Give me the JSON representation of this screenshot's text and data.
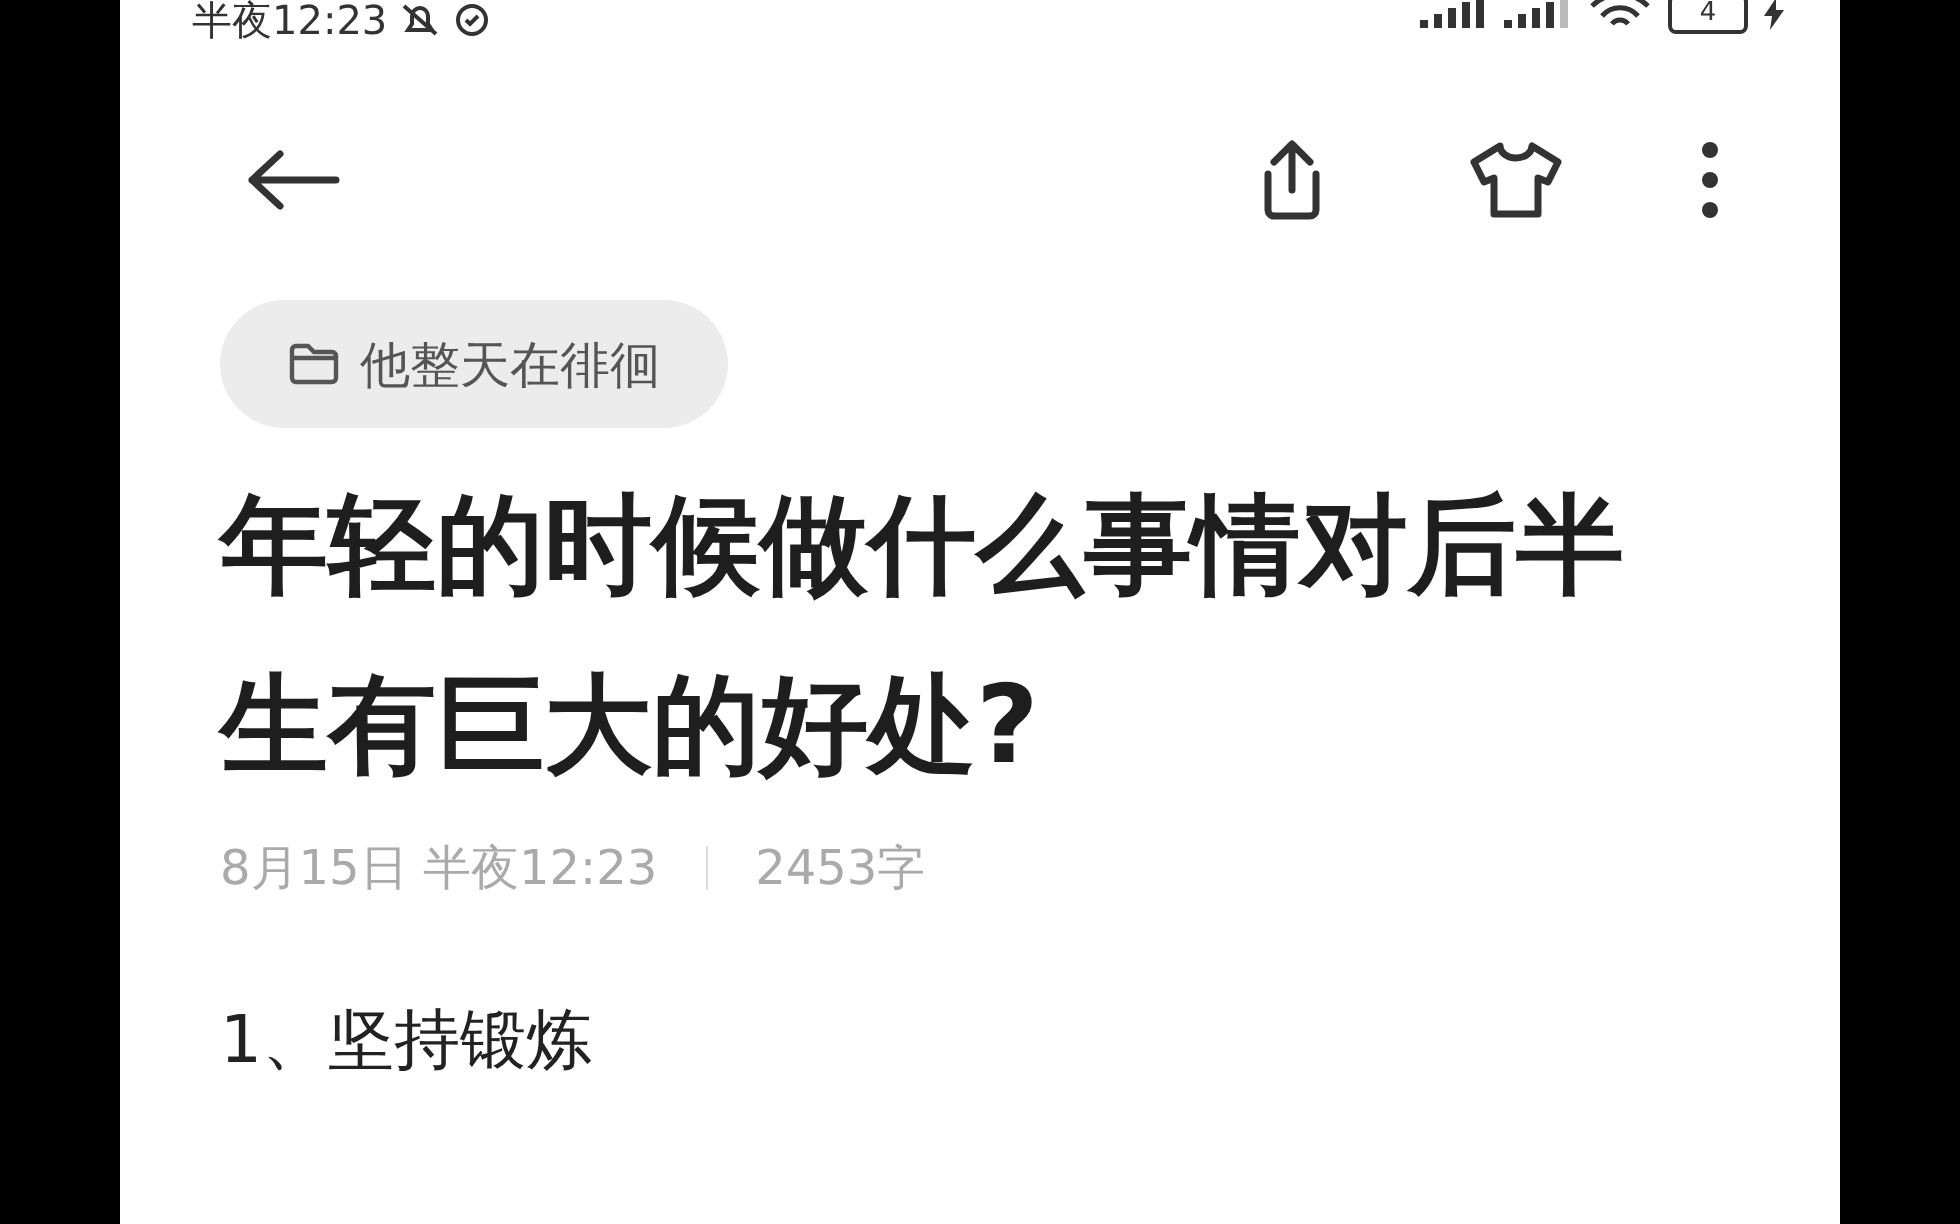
{
  "status_bar": {
    "time": "半夜12:23",
    "battery": "4"
  },
  "note": {
    "folder": "他整天在徘徊",
    "title": "年轻的时候做什么事情对后半生有巨大的好处?",
    "date": "8月15日 半夜12:23",
    "word_count": "2453字",
    "body": [
      "1、坚持锻炼"
    ]
  }
}
